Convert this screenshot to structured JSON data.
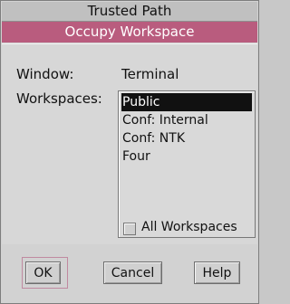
{
  "trusted_path": "Trusted Path",
  "dialog_title": "Occupy Workspace",
  "window_label": "Window:",
  "window_value": "Terminal",
  "workspaces_label": "Workspaces:",
  "workspaces": [
    "Public",
    "Conf: Internal",
    "Conf: NTK",
    "Four"
  ],
  "selected_workspace": "Public",
  "all_workspaces_label": "All Workspaces",
  "all_workspaces_checked": false,
  "buttons": {
    "ok": "OK",
    "cancel": "Cancel",
    "help": "Help"
  }
}
